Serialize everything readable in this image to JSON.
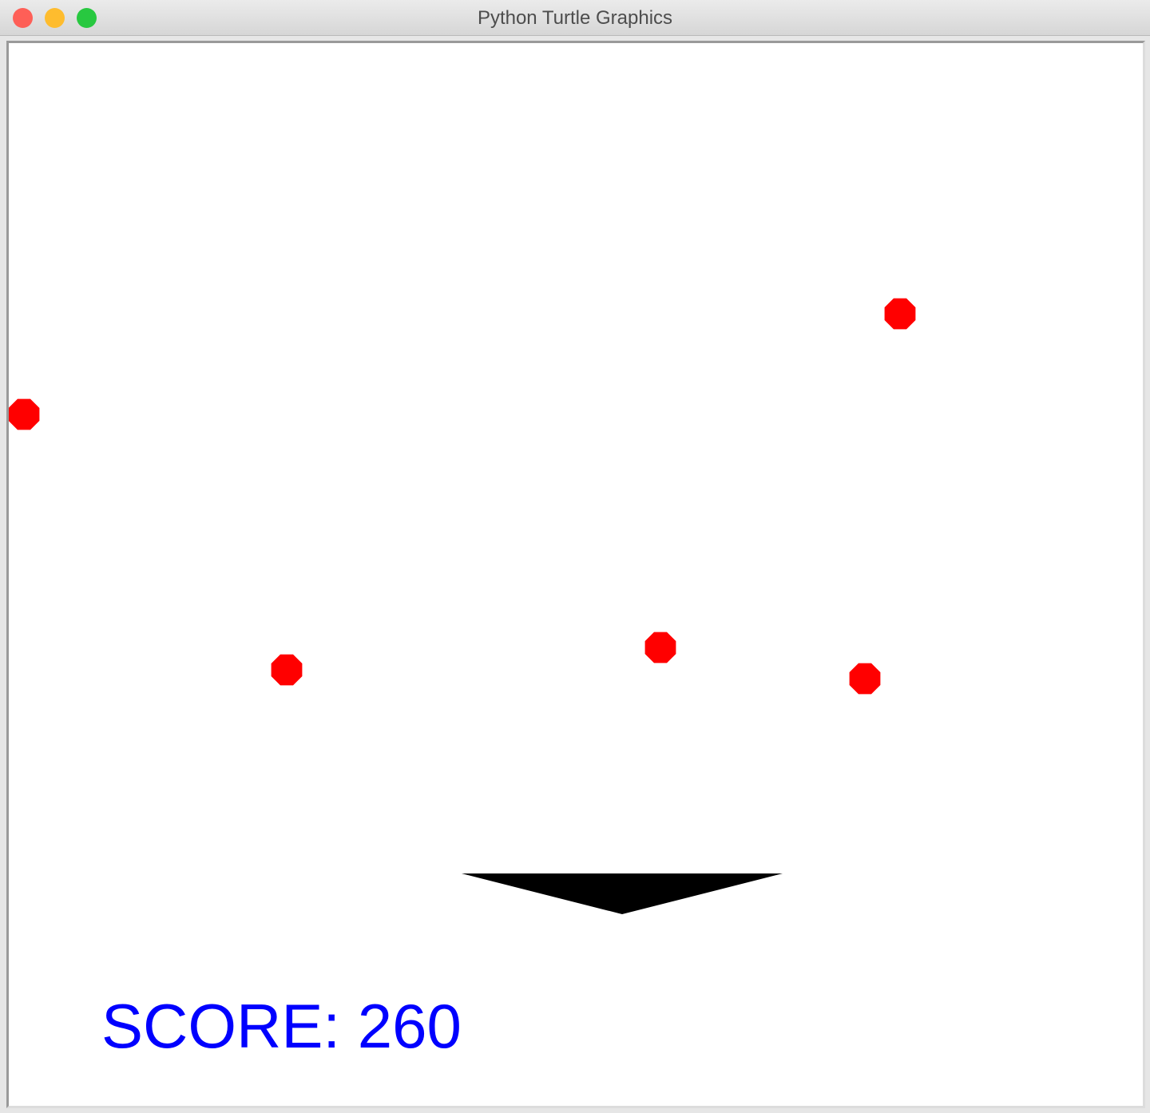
{
  "window": {
    "title": "Python Turtle Graphics",
    "buttons": {
      "close_color": "#fe5f57",
      "minimize_color": "#febc2e",
      "zoom_color": "#28c840"
    }
  },
  "game": {
    "score_label": "SCORE: 260",
    "score_value": 260,
    "score_color": "#0000ff",
    "ball_color": "#ff0000",
    "paddle_color": "#000000",
    "background_color": "#ffffff",
    "falling_balls": 5
  }
}
